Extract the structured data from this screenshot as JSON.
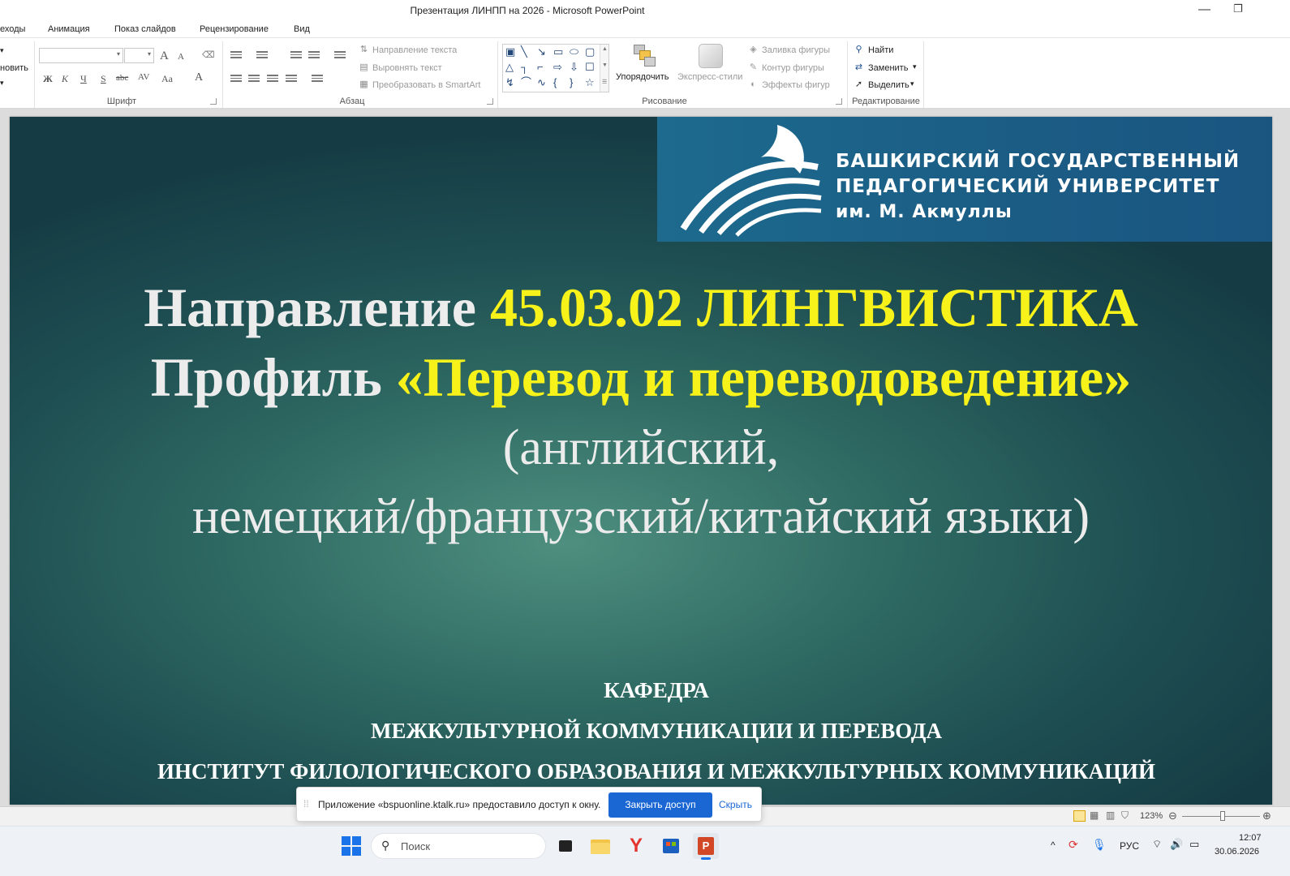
{
  "window": {
    "title": "Презентация ЛИНПП на 2026  -  Microsoft PowerPoint",
    "minimize_icon": "minimize-icon",
    "restore_icon": "restore-icon"
  },
  "menu": {
    "items": [
      "еходы",
      "Анимация",
      "Показ слайдов",
      "Рецензирование",
      "Вид"
    ]
  },
  "ribbon": {
    "clipboard_partial": "новить",
    "groups": {
      "font": "Шрифт",
      "paragraph": "Абзац",
      "drawing": "Рисование",
      "editing": "Редактирование"
    },
    "font": {
      "font_name_value": "",
      "font_size_value": "",
      "bold": "Ж",
      "italic": "К",
      "underline": "Ч",
      "strike": "S",
      "abc": "abc",
      "spacing": "AV",
      "case": "Aa",
      "color": "A",
      "grow": "A",
      "shrink": "A"
    },
    "paragraph": {
      "text_direction": "Направление текста",
      "align_text": "Выровнять текст",
      "smartart": "Преобразовать в SmartArt"
    },
    "drawing": {
      "arrange": "Упорядочить",
      "quick_styles": "Экспресс-стили",
      "shape_fill": "Заливка фигуры",
      "shape_outline": "Контур фигуры",
      "shape_effects": "Эффекты фигур"
    },
    "editing": {
      "find": "Найти",
      "replace": "Заменить",
      "select": "Выделить"
    }
  },
  "slide": {
    "logo": {
      "line1": "БАШКИРСКИЙ ГОСУДАРСТВЕННЫЙ",
      "line2": "ПЕДАГОГИЧЕСКИЙ УНИВЕРСИТЕТ",
      "line3": "им. М. Акмуллы"
    },
    "direction_label": "Направление",
    "direction_value": "45.03.02 ЛИНГВИСТИКА",
    "profile_label": "Профиль",
    "profile_value": "«Перевод и переводоведение»",
    "languages_line1": "(английский,",
    "languages_line2": "немецкий/французский/китайский языки)",
    "department_line1": "КАФЕДРА",
    "department_line2": "МЕЖКУЛЬТУРНОЙ КОММУНИКАЦИИ И ПЕРЕВОДА",
    "institute": "ИНСТИТУТ ФИЛОЛОГИЧЕСКОГО ОБРАЗОВАНИЯ И МЕЖКУЛЬТУРНЫХ КОММУНИКАЦИЙ",
    "colors": {
      "title_white": "#ececec",
      "accent_yellow": "#f7f21a",
      "background_dark": "#153c44",
      "background_light": "#4e8f7f"
    }
  },
  "share_notice": {
    "message": "Приложение «bspuonline.ktalk.ru» предоставило доступ к окну.",
    "close_button": "Закрыть доступ",
    "hide_link": "Скрыть"
  },
  "statusbar": {
    "zoom": "123%"
  },
  "taskbar": {
    "search_placeholder": "Поиск",
    "language": "РУС",
    "time": "12:07",
    "date": "30.06.2026"
  }
}
